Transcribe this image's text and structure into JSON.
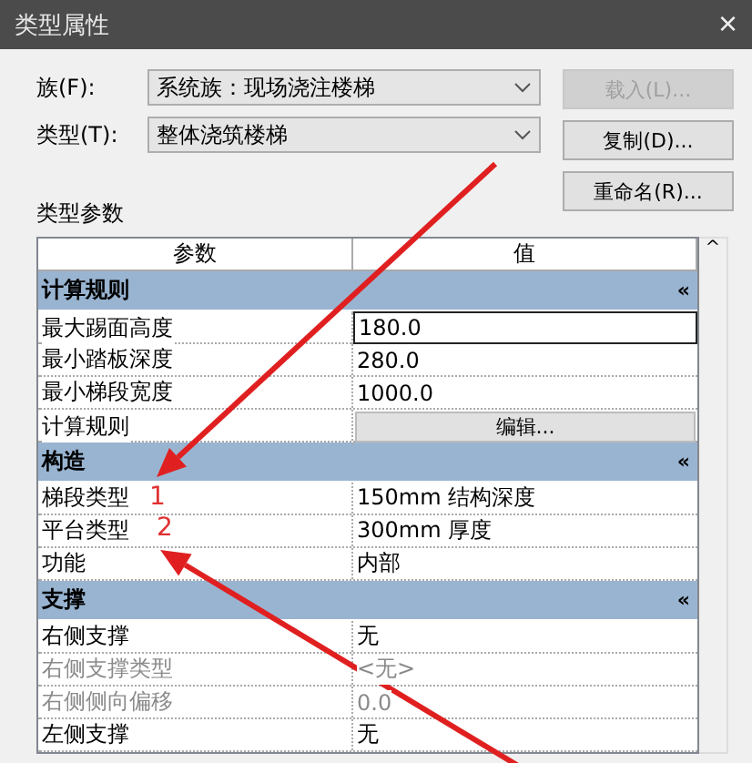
{
  "window": {
    "title": "类型属性",
    "close": "×"
  },
  "family": {
    "label": "族(F):",
    "value": "系统族：现场浇注楼梯"
  },
  "type": {
    "label": "类型(T):",
    "value": "整体浇筑楼梯"
  },
  "buttons": [
    {
      "label": "载入(L)...",
      "disabled": true
    },
    {
      "label": "复制(D)...",
      "disabled": false
    },
    {
      "label": "重命名(R)...",
      "disabled": false
    }
  ],
  "section_label": "类型参数",
  "table": {
    "columns": [
      "参数",
      "值"
    ],
    "scroll_up": "^",
    "groups": [
      {
        "title": "计算规则",
        "collapse": "«",
        "rows": [
          {
            "param": "最大踢面高度",
            "value": "180.0",
            "kind": "input",
            "disabled": false
          },
          {
            "param": "最小踏板深度",
            "value": "280.0",
            "kind": "text",
            "disabled": false
          },
          {
            "param": "最小梯段宽度",
            "value": "1000.0",
            "kind": "text",
            "disabled": false
          },
          {
            "param": "计算规则",
            "value": "编辑...",
            "kind": "button",
            "disabled": false
          }
        ]
      },
      {
        "title": "构造",
        "collapse": "«",
        "rows": [
          {
            "param": "梯段类型",
            "value": "150mm 结构深度",
            "kind": "text",
            "disabled": false
          },
          {
            "param": "平台类型",
            "value": "300mm 厚度",
            "kind": "text",
            "disabled": false
          },
          {
            "param": "功能",
            "value": "内部",
            "kind": "text",
            "disabled": false
          }
        ]
      },
      {
        "title": "支撑",
        "collapse": "«",
        "rows": [
          {
            "param": "右侧支撑",
            "value": "无",
            "kind": "text",
            "disabled": false
          },
          {
            "param": "右侧支撑类型",
            "value": "<无>",
            "kind": "text",
            "disabled": true
          },
          {
            "param": "右侧侧向偏移",
            "value": "0.0",
            "kind": "text",
            "disabled": true
          },
          {
            "param": "左侧支撑",
            "value": "无",
            "kind": "text",
            "disabled": false
          }
        ]
      }
    ]
  },
  "annotations": [
    {
      "label": "1"
    },
    {
      "label": "2"
    }
  ]
}
